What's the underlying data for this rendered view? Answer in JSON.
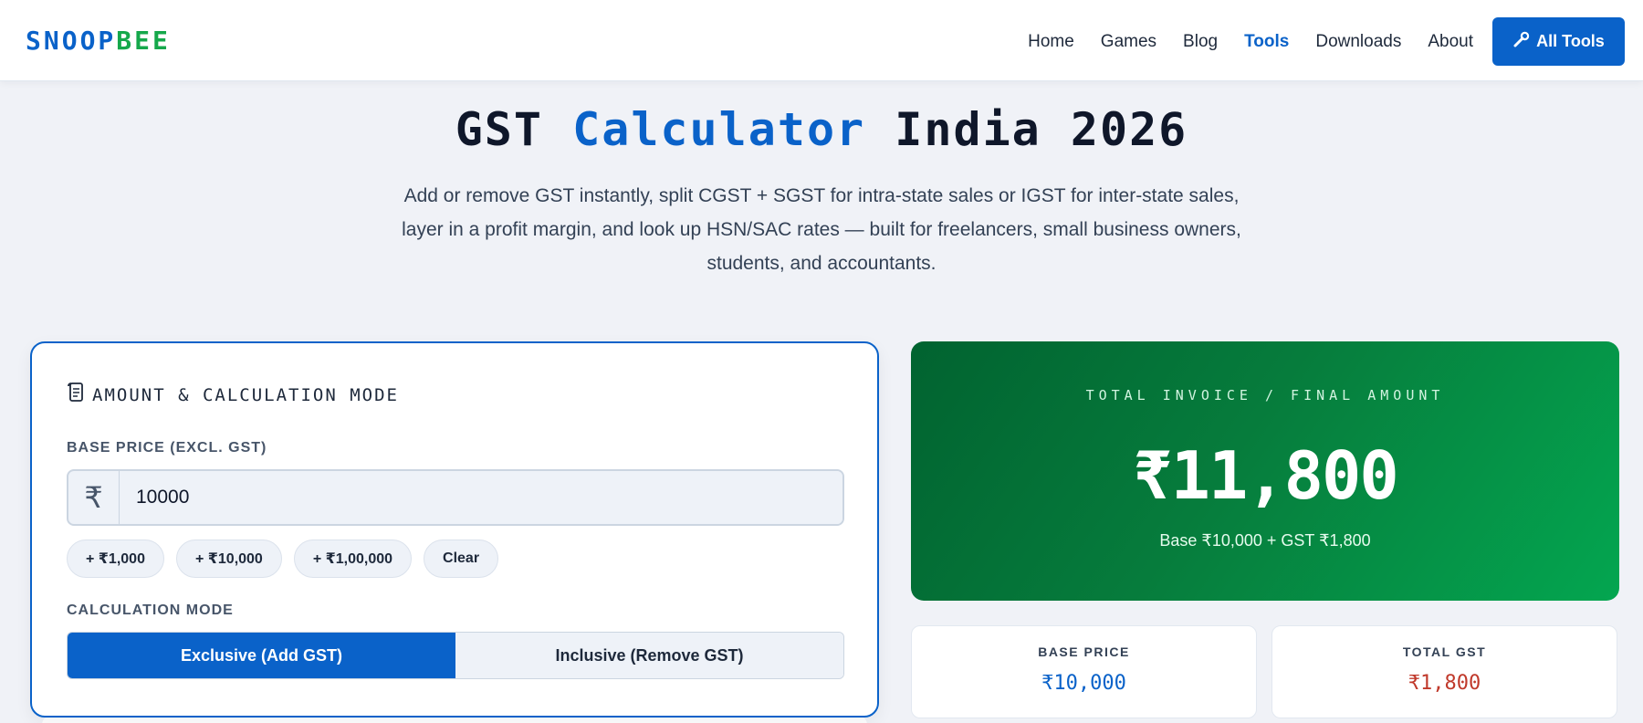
{
  "brand": {
    "part1": "SNOOP",
    "part2": "BEE"
  },
  "nav": {
    "links": [
      "Home",
      "Games",
      "Blog",
      "Tools",
      "Downloads",
      "About"
    ],
    "active": "Tools",
    "cta_label": "All Tools",
    "cta_icon": "wrench-icon"
  },
  "hero": {
    "title_pre": "GST ",
    "title_accent": "Calculator",
    "title_post": " India 2026",
    "description": "Add or remove GST instantly, split CGST + SGST for intra-state sales or IGST for inter-state sales, layer in a profit margin, and look up HSN/SAC rates — built for freelancers, small business owners, students, and accountants."
  },
  "calculator": {
    "heading": "AMOUNT & CALCULATION MODE",
    "heading_icon": "scroll-icon",
    "base_price_label": "BASE PRICE (EXCL. GST)",
    "currency_symbol": "₹",
    "base_price_value": "10000",
    "chips": [
      "+ ₹1,000",
      "+ ₹10,000",
      "+ ₹1,00,000",
      "Clear"
    ],
    "mode_label": "CALCULATION MODE",
    "mode_options": [
      "Exclusive (Add GST)",
      "Inclusive (Remove GST)"
    ],
    "selected_mode": "Exclusive (Add GST)"
  },
  "result": {
    "kicker": "TOTAL INVOICE / FINAL AMOUNT",
    "total": "₹11,800",
    "breakdown": "Base ₹10,000 + GST ₹1,800"
  },
  "stats": [
    {
      "label": "BASE PRICE",
      "value": "₹10,000",
      "color": "#0a62c9"
    },
    {
      "label": "TOTAL GST",
      "value": "₹1,800",
      "color": "#c0392b"
    }
  ],
  "colors": {
    "primary": "#0a62c9",
    "brand_green": "#15a84b",
    "result_gradient_start": "#016330",
    "result_gradient_end": "#04a650",
    "gst_red": "#c0392b"
  }
}
